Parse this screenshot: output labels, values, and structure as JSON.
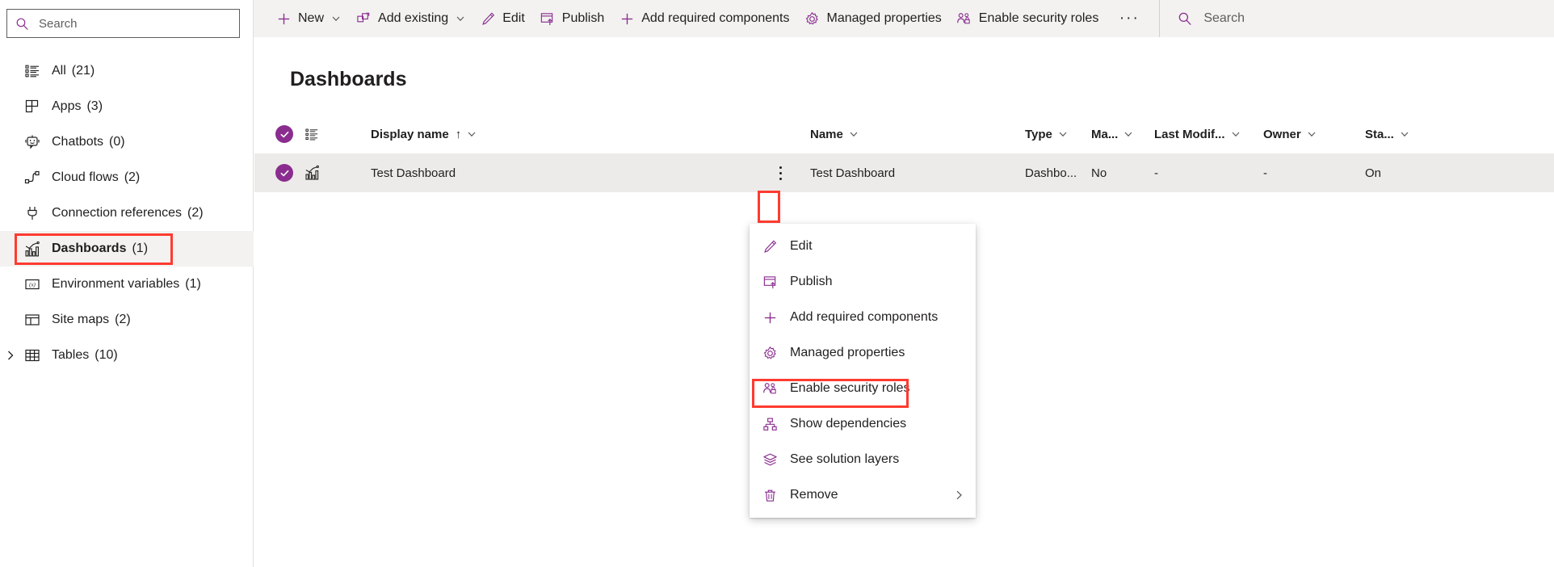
{
  "sidebar": {
    "search": {
      "value": "",
      "placeholder": "Search",
      "icon": "search-icon"
    },
    "items": [
      {
        "label": "All",
        "count": "(21)",
        "icon": "list-icon",
        "selected": false,
        "expandable": false
      },
      {
        "label": "Apps",
        "count": "(3)",
        "icon": "apps-grid-icon",
        "selected": false,
        "expandable": false
      },
      {
        "label": "Chatbots",
        "count": "(0)",
        "icon": "chatbot-icon",
        "selected": false,
        "expandable": false
      },
      {
        "label": "Cloud flows",
        "count": "(2)",
        "icon": "cloud-flow-icon",
        "selected": false,
        "expandable": false
      },
      {
        "label": "Connection references",
        "count": "(2)",
        "icon": "plug-icon",
        "selected": false,
        "expandable": false
      },
      {
        "label": "Dashboards",
        "count": "(1)",
        "icon": "dashboard-chart-icon",
        "selected": true,
        "expandable": false
      },
      {
        "label": "Environment variables",
        "count": "(1)",
        "icon": "environment-variable-icon",
        "selected": false,
        "expandable": false
      },
      {
        "label": "Site maps",
        "count": "(2)",
        "icon": "sitemap-layout-icon",
        "selected": false,
        "expandable": false
      },
      {
        "label": "Tables",
        "count": "(10)",
        "icon": "table-icon",
        "selected": false,
        "expandable": true
      }
    ]
  },
  "commandbar": {
    "buttons": [
      {
        "label": "New",
        "icon": "plus-icon",
        "chevron": true
      },
      {
        "label": "Add existing",
        "icon": "add-existing-icon",
        "chevron": true
      },
      {
        "label": "Edit",
        "icon": "pencil-icon",
        "chevron": false
      },
      {
        "label": "Publish",
        "icon": "publish-icon",
        "chevron": false
      },
      {
        "label": "Add required components",
        "icon": "plus-icon",
        "chevron": false
      },
      {
        "label": "Managed properties",
        "icon": "gear-icon",
        "chevron": false
      },
      {
        "label": "Enable security roles",
        "icon": "security-roles-icon",
        "chevron": false
      }
    ],
    "overflow_label": "···",
    "search": {
      "value": "",
      "placeholder": "Search",
      "icon": "search-icon"
    }
  },
  "main": {
    "title": "Dashboards",
    "columns": [
      {
        "key": "display_name",
        "label": "Display name",
        "sort": "↑",
        "chevron": true
      },
      {
        "key": "name",
        "label": "Name",
        "sort": "",
        "chevron": true
      },
      {
        "key": "type",
        "label": "Type",
        "sort": "",
        "chevron": true
      },
      {
        "key": "managed",
        "label": "Ma...",
        "sort": "",
        "chevron": true
      },
      {
        "key": "last_modified",
        "label": "Last Modif...",
        "sort": "",
        "chevron": true
      },
      {
        "key": "owner",
        "label": "Owner",
        "sort": "",
        "chevron": true
      },
      {
        "key": "status",
        "label": "Sta...",
        "sort": "",
        "chevron": true
      }
    ],
    "rows": [
      {
        "selected": true,
        "row_icon": "dashboard-chart-icon",
        "display_name": "Test Dashboard",
        "name": "Test Dashboard",
        "type": "Dashbo...",
        "managed": "No",
        "last_modified": "-",
        "owner": "-",
        "status": "On"
      }
    ]
  },
  "context_menu": {
    "items": [
      {
        "label": "Edit",
        "icon": "pencil-icon",
        "submenu": false,
        "highlighted": false
      },
      {
        "label": "Publish",
        "icon": "publish-icon",
        "submenu": false,
        "highlighted": false
      },
      {
        "label": "Add required components",
        "icon": "plus-icon",
        "submenu": false,
        "highlighted": false
      },
      {
        "label": "Managed properties",
        "icon": "gear-icon",
        "submenu": false,
        "highlighted": false
      },
      {
        "label": "Enable security roles",
        "icon": "security-roles-icon",
        "submenu": false,
        "highlighted": true
      },
      {
        "label": "Show dependencies",
        "icon": "dependencies-icon",
        "submenu": false,
        "highlighted": false
      },
      {
        "label": "See solution layers",
        "icon": "layers-icon",
        "submenu": false,
        "highlighted": false
      },
      {
        "label": "Remove",
        "icon": "trash-icon",
        "submenu": true,
        "highlighted": false
      }
    ],
    "submenu_chevron": "chevron-right-icon"
  },
  "colors": {
    "accent_purple": "#8a2d8f",
    "highlight_red": "#ff3b30",
    "commandbar_bg": "#f3f2f1",
    "row_selected_bg": "#edebe9",
    "text_primary": "#201f1e"
  }
}
